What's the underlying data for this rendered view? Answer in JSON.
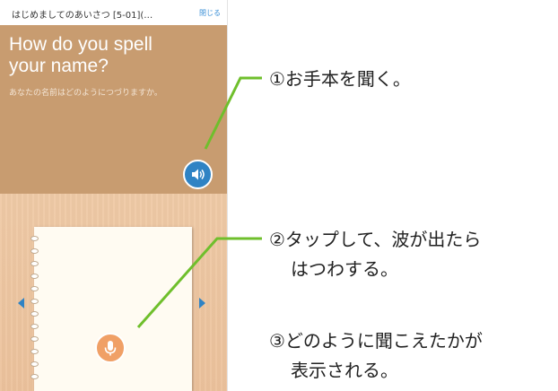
{
  "app": {
    "title": "はじめましてのあいさつ [5-01](…",
    "close_label": "閉じる"
  },
  "question": {
    "english": "How do you spell your name?",
    "japanese": "あなたの名前はどのようにつづりますか。"
  },
  "buttons": {
    "speaker_icon": "speaker-icon",
    "mic_icon": "microphone-icon",
    "prev_icon": "chevron-left-icon",
    "next_icon": "chevron-right-icon"
  },
  "annotations": {
    "step1": "①お手本を聞く。",
    "step2_line1": "②タップして、波が出たら",
    "step2_line2": "はつわする。",
    "step3_line1": "③どのように聞こえたかが",
    "step3_line2": "表示される。"
  },
  "colors": {
    "accent_blue": "#2f83c4",
    "panel_brown": "#c89c70",
    "mic_orange": "#f0a066",
    "callout_green": "#6fbf2c"
  }
}
